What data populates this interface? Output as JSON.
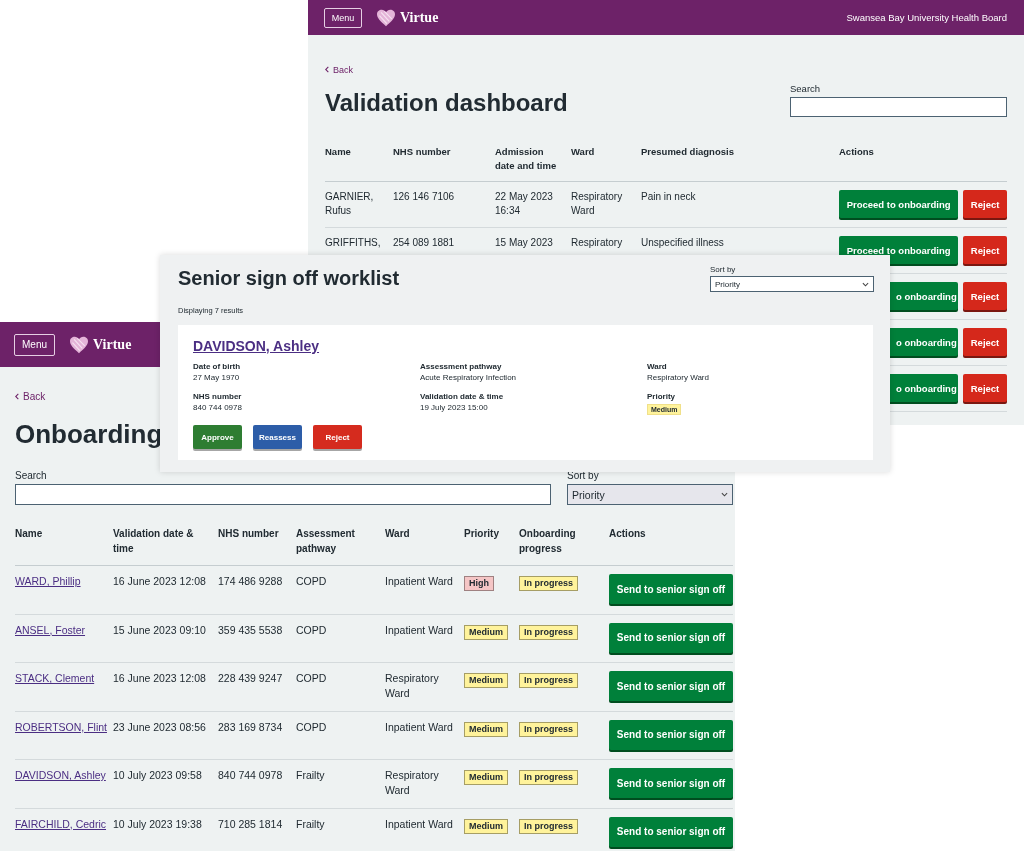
{
  "validation_window": {
    "header": {
      "menu": "Menu",
      "logo": "Virtue",
      "organisation": "Swansea Bay University Health Board"
    },
    "back": "Back",
    "title": "Validation dashboard",
    "search": {
      "label": "Search"
    },
    "columns": [
      "Name",
      "NHS number",
      "Admission date and time",
      "Ward",
      "Presumed diagnosis",
      "Actions"
    ],
    "rows": [
      {
        "name": "GARNIER, Rufus",
        "nhs_number": "126 146 7106",
        "admission": "22 May 2023 16:34",
        "ward": "Respiratory Ward",
        "diagnosis": "Pain in neck",
        "action": "Proceed to onboarding",
        "reject": "Reject"
      },
      {
        "name": "GRIFFITHS,",
        "nhs_number": "254 089 1881",
        "admission": "15 May 2023",
        "ward": "Respiratory",
        "diagnosis": "Unspecified illness",
        "action": "Proceed to onboarding",
        "reject": "Reject"
      },
      {
        "action": "o onboarding",
        "reject": "Reject"
      },
      {
        "action": "o onboarding",
        "reject": "Reject"
      },
      {
        "action": "o onboarding",
        "reject": "Reject"
      }
    ]
  },
  "onboarding_window": {
    "header": {
      "menu": "Menu",
      "logo": "Virtue"
    },
    "back": "Back",
    "title": "Onboarding",
    "search": {
      "label": "Search"
    },
    "sort": {
      "label": "Sort by",
      "value": "Priority"
    },
    "columns": [
      "Name",
      "Validation date & time",
      "NHS number",
      "Assessment pathway",
      "Ward",
      "Priority",
      "Onboarding progress",
      "Actions"
    ],
    "rows": [
      {
        "name": "WARD, Phillip",
        "validated": "16 June 2023 12:08",
        "nhs_number": "174 486 9288",
        "pathway": "COPD",
        "ward": "Inpatient Ward",
        "priority": {
          "text": "High",
          "color": "#f5c6c6"
        },
        "progress": {
          "text": "In progress",
          "color": "#fff39b"
        },
        "action": "Send to senior sign off"
      },
      {
        "name": "ANSEL, Foster",
        "validated": "15 June 2023 09:10",
        "nhs_number": "359 435 5538",
        "pathway": "COPD",
        "ward": "Inpatient Ward",
        "priority": {
          "text": "Medium",
          "color": "#fff39b"
        },
        "progress": {
          "text": "In progress",
          "color": "#fff39b"
        },
        "action": "Send to senior sign off"
      },
      {
        "name": "STACK, Clement",
        "validated": "16 June 2023 12:08",
        "nhs_number": "228 439 9247",
        "pathway": "COPD",
        "ward": "Respiratory Ward",
        "priority": {
          "text": "Medium",
          "color": "#fff39b"
        },
        "progress": {
          "text": "In progress",
          "color": "#fff39b"
        },
        "action": "Send to senior sign off"
      },
      {
        "name": "ROBERTSON, Flint",
        "validated": "23 June 2023 08:56",
        "nhs_number": "283 169 8734",
        "pathway": "COPD",
        "ward": "Inpatient Ward",
        "priority": {
          "text": "Medium",
          "color": "#fff39b"
        },
        "progress": {
          "text": "In progress",
          "color": "#fff39b"
        },
        "action": "Send to senior sign off"
      },
      {
        "name": "DAVIDSON, Ashley",
        "validated": "10 July 2023 09:58",
        "nhs_number": "840 744 0978",
        "pathway": "Frailty",
        "ward": "Respiratory Ward",
        "priority": {
          "text": "Medium",
          "color": "#fff39b"
        },
        "progress": {
          "text": "In progress",
          "color": "#fff39b"
        },
        "action": "Send to senior sign off"
      },
      {
        "name": "FAIRCHILD, Cedric",
        "validated": "10 July 2023 19:38",
        "nhs_number": "710 285 1814",
        "pathway": "Frailty",
        "ward": "Inpatient Ward",
        "priority": {
          "text": "Medium",
          "color": "#fff39b"
        },
        "progress": {
          "text": "In progress",
          "color": "#fff39b"
        },
        "action": "Send to senior sign off"
      }
    ]
  },
  "senior_sign_off": {
    "title": "Senior sign off worklist",
    "sort": {
      "label": "Sort by",
      "value": "Priority"
    },
    "result_count": "Displaying 7 results",
    "card": {
      "name": "DAVIDSON, Ashley",
      "fields": [
        {
          "label": "Date of birth",
          "value": "27 May 1970"
        },
        {
          "label": "Assessment pathway",
          "value": "Acute Respiratory Infection"
        },
        {
          "label": "Ward",
          "value": "Respiratory Ward"
        },
        {
          "label": "NHS number",
          "value": "840 744 0978"
        },
        {
          "label": "Validation date & time",
          "value": "19 July 2023 15:00"
        },
        {
          "label": "Priority",
          "value": "Medium",
          "kind": "tag",
          "color": "#fff39b"
        }
      ],
      "buttons": [
        {
          "label": "Approve",
          "kind": "approve"
        },
        {
          "label": "Reassess",
          "kind": "reassess"
        },
        {
          "label": "Reject",
          "kind": "reject"
        }
      ]
    }
  }
}
